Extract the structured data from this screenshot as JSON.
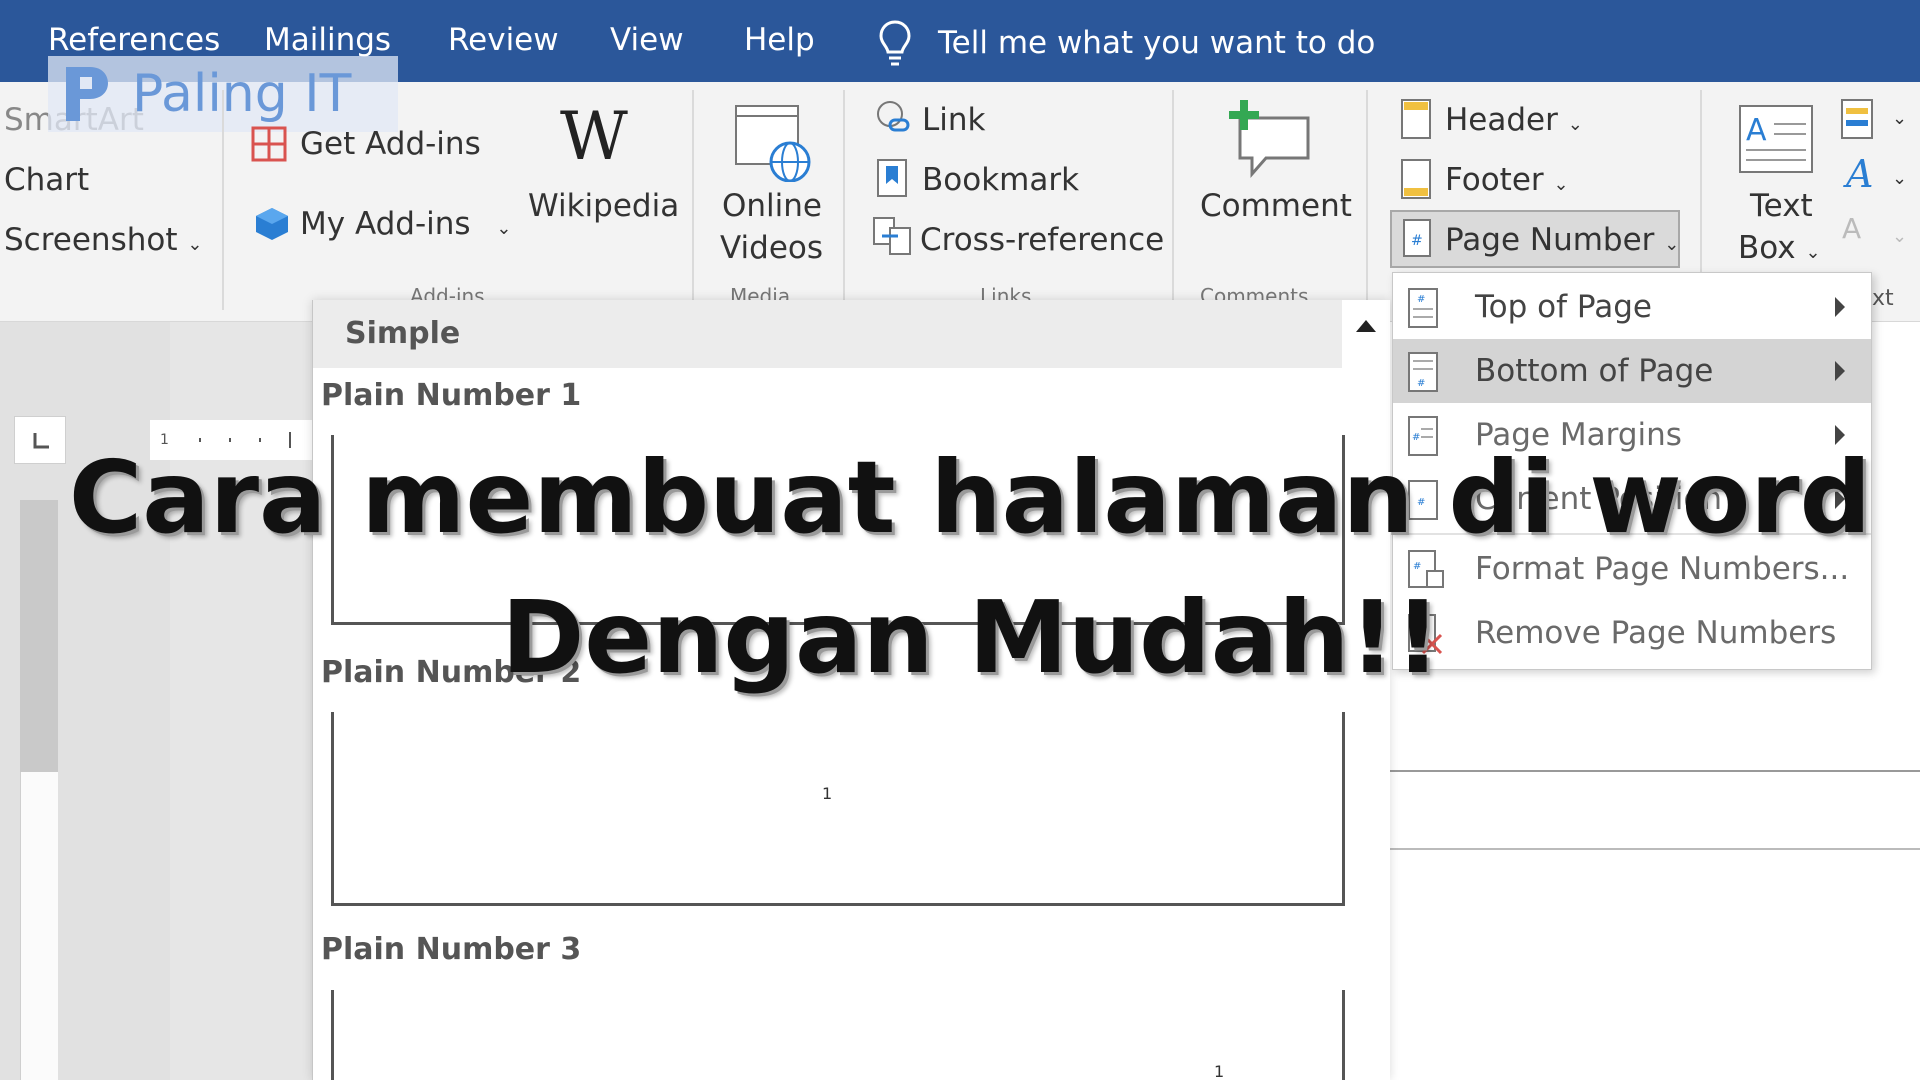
{
  "ribbon_tabs": [
    "References",
    "Mailings",
    "Review",
    "View",
    "Help"
  ],
  "tell_me": "Tell me what you want to do",
  "watermark": "Paling IT",
  "illustrations": {
    "smartart": "SmartArt",
    "chart": "Chart",
    "screenshot": "Screenshot"
  },
  "addins": {
    "get": "Get Add-ins",
    "my": "My Add-ins",
    "wikipedia": "Wikipedia",
    "group": "Add-ins"
  },
  "media": {
    "online": "Online",
    "videos": "Videos",
    "group": "Media"
  },
  "links": {
    "link": "Link",
    "bookmark": "Bookmark",
    "crossref": "Cross-reference",
    "group": "Links"
  },
  "comments": {
    "comment": "Comment",
    "group": "Comments"
  },
  "header_footer": {
    "header": "Header",
    "footer": "Footer",
    "page_number": "Page Number"
  },
  "text_group": {
    "text": "Text",
    "box": "Box",
    "group_partial": "xt"
  },
  "gallery": {
    "section": "Simple",
    "items": [
      "Plain Number 1",
      "Plain Number 2",
      "Plain Number 3"
    ],
    "sample_number": "1"
  },
  "menu": {
    "items": [
      {
        "label": "Top of Page",
        "submenu": true
      },
      {
        "label": "Bottom of Page",
        "submenu": true,
        "active": true
      },
      {
        "label": "Page Margins",
        "submenu": true
      },
      {
        "label": "Current Position",
        "submenu": true
      },
      {
        "label": "Format Page Numbers...",
        "submenu": false
      },
      {
        "label": "Remove Page Numbers",
        "submenu": false
      }
    ]
  },
  "overlay_title": {
    "line1": "Cara membuat halaman di word",
    "line2": "Dengan Mudah!!"
  },
  "colors": {
    "ribbon_blue": "#2b579a",
    "ribbon_bg": "#f3f3f3",
    "menu_active": "#d4d4d4"
  }
}
